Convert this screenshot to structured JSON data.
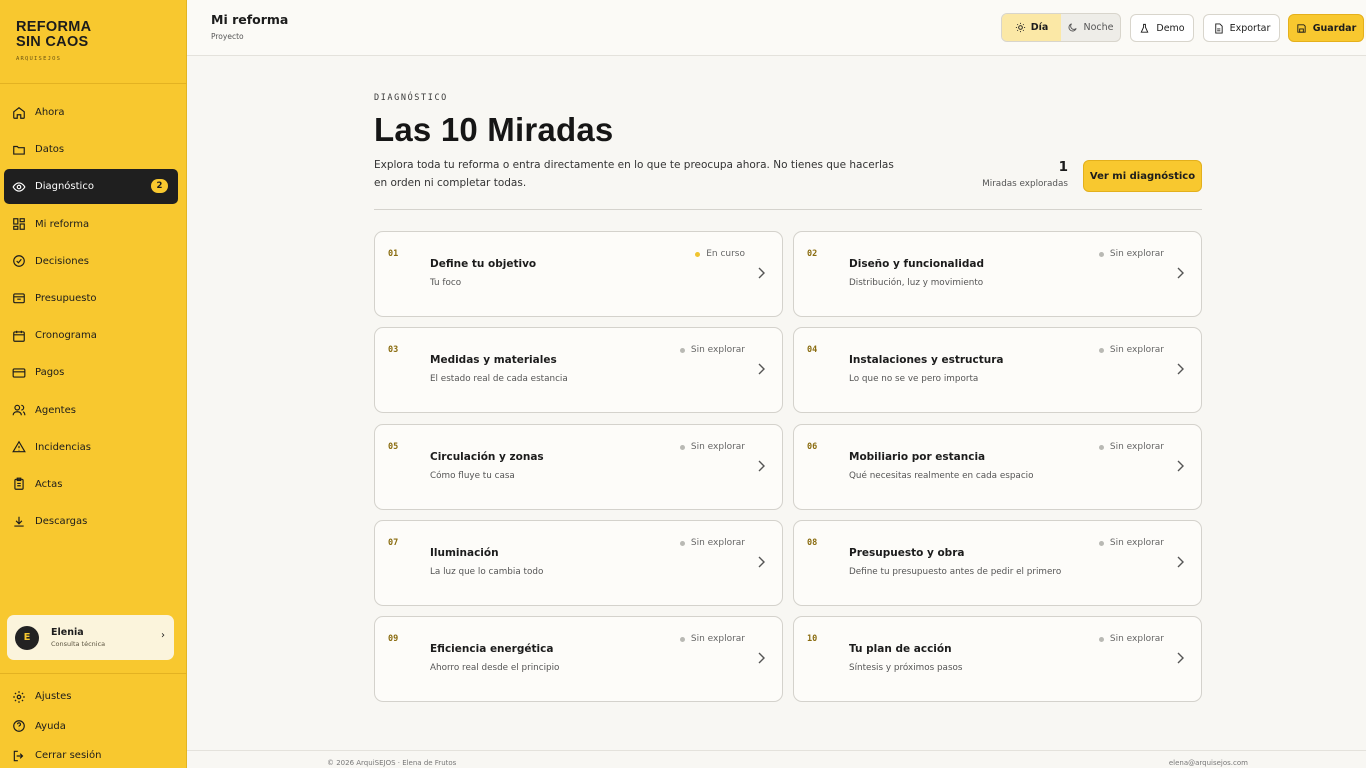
{
  "brand": {
    "line1": "REFORMA",
    "line2": "SIN CAOS",
    "sub": "ARQUISEJOS"
  },
  "nav": [
    {
      "label": "Ahora",
      "icon": "home-icon"
    },
    {
      "label": "Datos",
      "icon": "folder-icon"
    },
    {
      "label": "Diagnóstico",
      "icon": "eye-icon",
      "badge": "2",
      "active": true
    },
    {
      "label": "Mi reforma",
      "icon": "grid-icon"
    },
    {
      "label": "Decisiones",
      "icon": "check-circle-icon"
    },
    {
      "label": "Presupuesto",
      "icon": "wallet-icon"
    },
    {
      "label": "Cronograma",
      "icon": "calendar-icon"
    },
    {
      "label": "Pagos",
      "icon": "card-icon"
    },
    {
      "label": "Agentes",
      "icon": "users-icon"
    },
    {
      "label": "Incidencias",
      "icon": "warning-icon"
    },
    {
      "label": "Actas",
      "icon": "clipboard-icon"
    },
    {
      "label": "Descargas",
      "icon": "download-icon"
    }
  ],
  "user": {
    "initial": "E",
    "name": "Elenia",
    "role": "Consulta técnica"
  },
  "bottom_nav": [
    {
      "label": "Ajustes",
      "icon": "gear-icon"
    },
    {
      "label": "Ayuda",
      "icon": "help-icon"
    },
    {
      "label": "Cerrar sesión",
      "icon": "logout-icon"
    }
  ],
  "topbar": {
    "title": "Mi reforma",
    "subtitle": "Proyecto",
    "theme_day": "Día",
    "theme_night": "Noche",
    "demo": "Demo",
    "export": "Exportar",
    "save": "Guardar"
  },
  "main": {
    "eyebrow": "DIAGNÓSTICO",
    "title": "Las 10 Miradas",
    "intro": "Explora toda tu reforma o entra directamente en lo que te preocupa ahora. No tienes que hacerlas en orden ni completar todas.",
    "count": "1",
    "count_label": "Miradas exploradas",
    "cta": "Ver mi diagnóstico"
  },
  "cards": [
    {
      "num": "01",
      "title": "Define tu objetivo",
      "sub": "Tu foco",
      "status": "En curso",
      "active": true
    },
    {
      "num": "02",
      "title": "Diseño y funcionalidad",
      "sub": "Distribución, luz y movimiento",
      "status": "Sin explorar"
    },
    {
      "num": "03",
      "title": "Medidas y materiales",
      "sub": "El estado real de cada estancia",
      "status": "Sin explorar"
    },
    {
      "num": "04",
      "title": "Instalaciones y estructura",
      "sub": "Lo que no se ve pero importa",
      "status": "Sin explorar"
    },
    {
      "num": "05",
      "title": "Circulación y zonas",
      "sub": "Cómo fluye tu casa",
      "status": "Sin explorar"
    },
    {
      "num": "06",
      "title": "Mobiliario por estancia",
      "sub": "Qué necesitas realmente en cada espacio",
      "status": "Sin explorar"
    },
    {
      "num": "07",
      "title": "Iluminación",
      "sub": "La luz que lo cambia todo",
      "status": "Sin explorar"
    },
    {
      "num": "08",
      "title": "Presupuesto y obra",
      "sub": "Define tu presupuesto antes de pedir el primero",
      "status": "Sin explorar"
    },
    {
      "num": "09",
      "title": "Eficiencia energética",
      "sub": "Ahorro real desde el principio",
      "status": "Sin explorar"
    },
    {
      "num": "10",
      "title": "Tu plan de acción",
      "sub": "Síntesis y próximos pasos",
      "status": "Sin explorar"
    }
  ],
  "footer": {
    "left": "© 2026 ArquiSEJOS · Elena de Frutos",
    "right": "elena@arquisejos.com"
  },
  "colors": {
    "accent": "#f8c82f",
    "dark": "#1f1f1f",
    "background": "#f8f7f3"
  }
}
